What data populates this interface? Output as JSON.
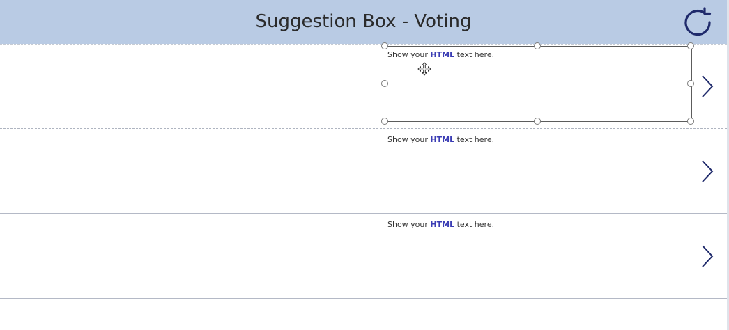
{
  "header": {
    "title": "Suggestion Box - Voting",
    "refresh_icon": "refresh-icon",
    "background": "#b9cbe4",
    "icon_color": "#1f2a6b"
  },
  "gallery": {
    "items": [
      {
        "html_prefix": "Show your ",
        "html_bold": "HTML",
        "html_suffix": " text here.",
        "chevron_icon": "chevron-right-icon",
        "selected": true
      },
      {
        "html_prefix": "Show your ",
        "html_bold": "HTML",
        "html_suffix": " text here.",
        "chevron_icon": "chevron-right-icon",
        "selected": false
      },
      {
        "html_prefix": "Show your ",
        "html_bold": "HTML",
        "html_suffix": " text here.",
        "chevron_icon": "chevron-right-icon",
        "selected": false
      }
    ],
    "selection_icon": "move-cursor-icon"
  }
}
